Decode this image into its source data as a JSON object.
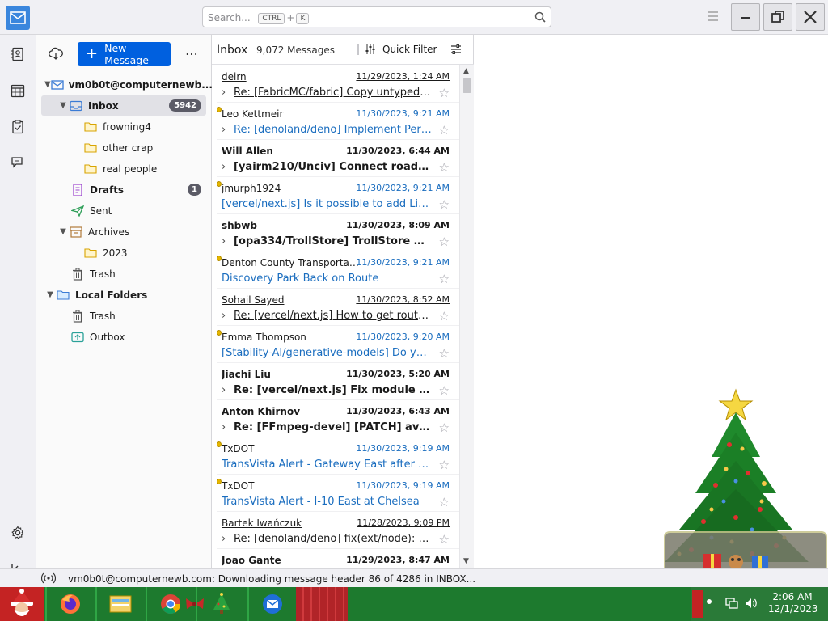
{
  "search": {
    "placeholder": "Search...",
    "key1": "CTRL",
    "plus": "+",
    "key2": "K"
  },
  "folder_pane": {
    "new_message": "New Message",
    "account": "vm0b0t@computernewb...",
    "folders": [
      {
        "name": "Inbox",
        "badge": "5942"
      },
      {
        "name": "frowning4"
      },
      {
        "name": "other crap"
      },
      {
        "name": "real people"
      },
      {
        "name": "Drafts",
        "badge": "1"
      },
      {
        "name": "Sent"
      },
      {
        "name": "Archives"
      },
      {
        "name": "2023"
      },
      {
        "name": "Trash"
      }
    ],
    "local_folders": {
      "name": "Local Folders",
      "children": [
        "Trash",
        "Outbox"
      ]
    }
  },
  "thread_pane": {
    "folder": "Inbox",
    "count": "9,072 Messages",
    "quick_filter": "Quick Filter",
    "messages": [
      {
        "sender": "deirn",
        "date": "11/29/2023, 1:24 AM",
        "subject": "Re: [FabricMC/fabric] Copy untyped pay...",
        "state": "read",
        "thread": true,
        "dot": false
      },
      {
        "sender": "Leo Kettmeir",
        "date": "11/30/2023, 9:21 AM",
        "subject": "Re: [denoland/deno] Implement Perf...",
        "state": "new",
        "thread": true,
        "dot": true
      },
      {
        "sender": "Will Allen",
        "date": "11/30/2023, 6:44 AM",
        "subject": "[yairm210/Unciv] Connect roads auto...",
        "state": "unread",
        "thread": true,
        "dot": false
      },
      {
        "sender": "jmurph1924",
        "date": "11/30/2023, 9:21 AM",
        "subject": "[vercel/next.js] Is it possible to add Lin...",
        "state": "new",
        "thread": false,
        "dot": true
      },
      {
        "sender": "shbwb",
        "date": "11/30/2023, 8:09 AM",
        "subject": "[opa334/TrollStore] TrollStore Can't b...",
        "state": "unread",
        "thread": true,
        "dot": false
      },
      {
        "sender": "Denton County Transportati...",
        "date": "11/30/2023, 9:21 AM",
        "subject": "Discovery Park Back on Route",
        "state": "new",
        "thread": false,
        "dot": true
      },
      {
        "sender": "Sohail Sayed",
        "date": "11/30/2023, 8:52 AM",
        "subject": "Re: [vercel/next.js] How to get router.qu...",
        "state": "read",
        "thread": true,
        "dot": false
      },
      {
        "sender": "Emma Thompson",
        "date": "11/30/2023, 9:20 AM",
        "subject": "[Stability-AI/generative-models] Do yo...",
        "state": "new",
        "thread": false,
        "dot": true
      },
      {
        "sender": "Jiachi Liu",
        "date": "11/30/2023, 5:20 AM",
        "subject": "Re: [vercel/next.js] Fix module resolv...",
        "state": "unread",
        "thread": true,
        "dot": false
      },
      {
        "sender": "Anton Khirnov",
        "date": "11/30/2023, 6:43 AM",
        "subject": "Re: [FFmpeg-devel] [PATCH] avfilter: ...",
        "state": "unread",
        "thread": true,
        "dot": false
      },
      {
        "sender": "TxDOT",
        "date": "11/30/2023, 9:19 AM",
        "subject": "TransVista Alert - Gateway East after Ra...",
        "state": "new",
        "thread": false,
        "dot": true
      },
      {
        "sender": "TxDOT",
        "date": "11/30/2023, 9:19 AM",
        "subject": "TransVista Alert - I-10 East at Chelsea",
        "state": "new",
        "thread": false,
        "dot": true
      },
      {
        "sender": "Bartek Iwańczuk",
        "date": "11/28/2023, 9:09 PM",
        "subject": "Re: [denoland/deno] fix(ext/node): add ...",
        "state": "read",
        "thread": true,
        "dot": false
      },
      {
        "sender": "Joao Gante",
        "date": "11/29/2023, 8:47 AM",
        "subject": "",
        "state": "unread",
        "thread": false,
        "dot": false
      }
    ]
  },
  "status": {
    "text": "vm0b0t@computernewb.com: Downloading message header 86 of 4286 in INBOX..."
  },
  "taskbar": {
    "time": "2:06 AM",
    "date": "12/1/2023"
  },
  "colors": {
    "accent": "#0060df",
    "new_mail": "#1a6dbf",
    "app_icon": "#3a86dd",
    "taskbar": "#1d7a2e"
  }
}
